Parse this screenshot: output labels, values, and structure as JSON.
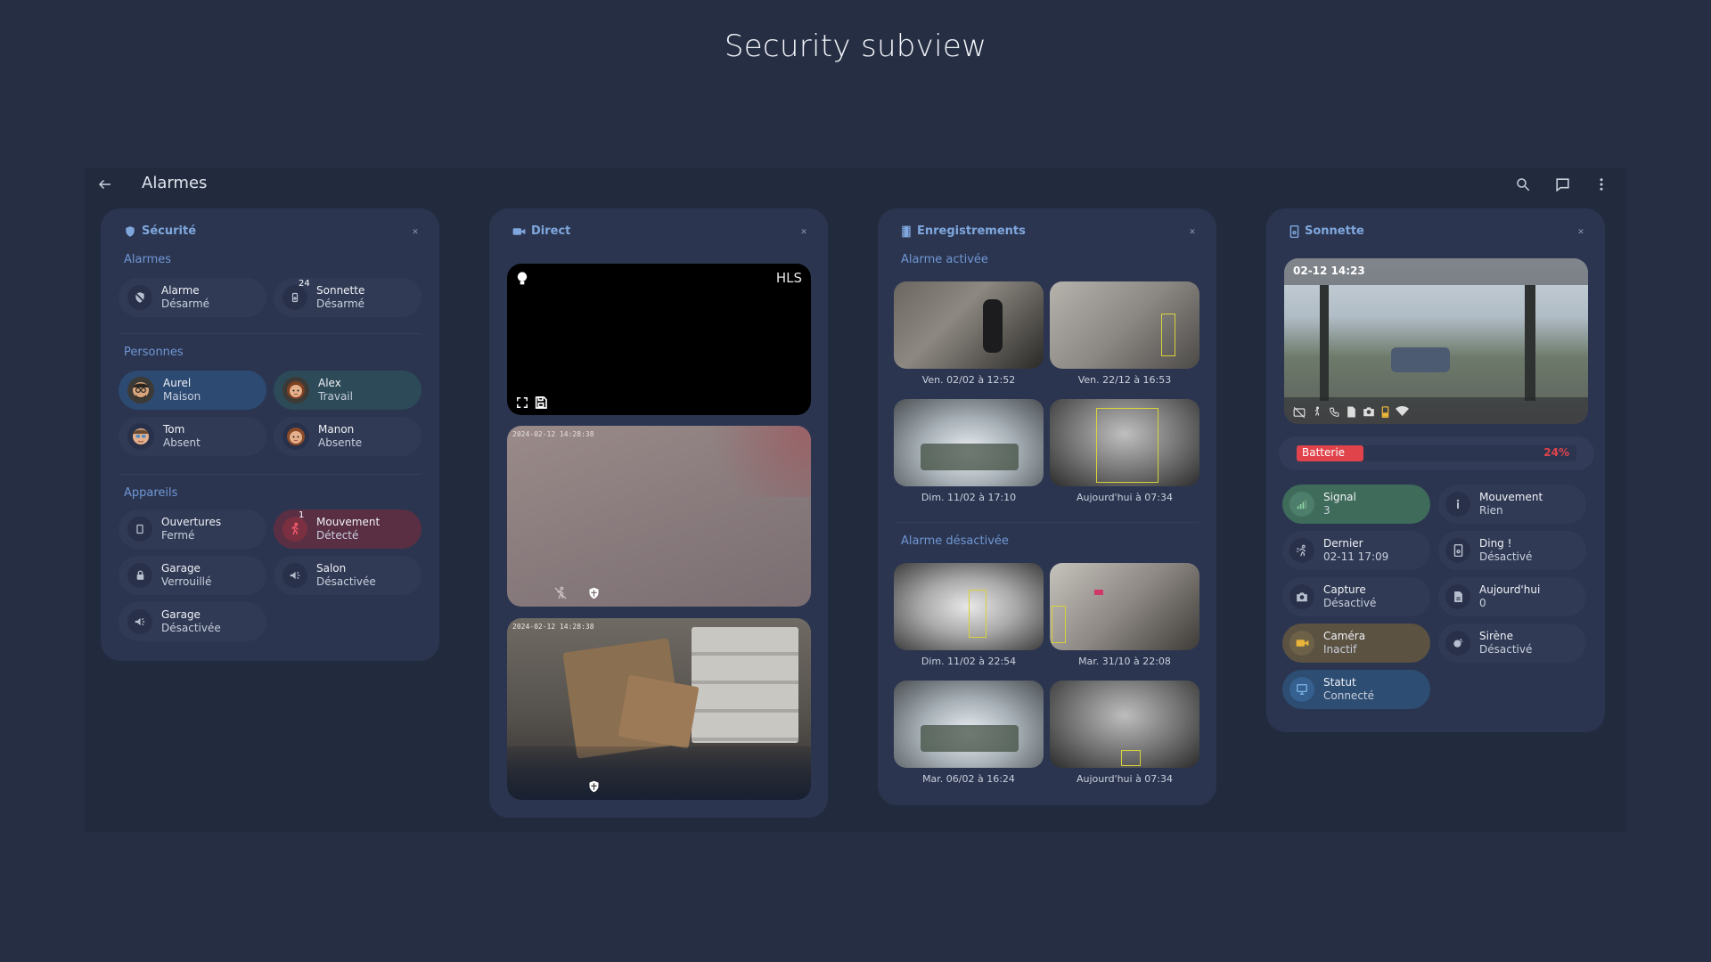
{
  "page_title": "Security subview",
  "topbar": {
    "title": "Alarmes",
    "back_icon": "arrow-left-icon",
    "actions": [
      "search-icon",
      "chat-icon",
      "more-vertical-icon"
    ]
  },
  "security": {
    "title": "Sécurité",
    "alarms_label": "Alarmes",
    "alarms": [
      {
        "name": "Alarme",
        "state": "Désarmé",
        "icon": "shield-off-icon"
      },
      {
        "name": "Sonnette",
        "state": "Désarmé",
        "icon": "doorbell-icon",
        "badge": "24"
      }
    ],
    "people_label": "Personnes",
    "people": [
      {
        "name": "Aurel",
        "state": "Maison"
      },
      {
        "name": "Alex",
        "state": "Travail"
      },
      {
        "name": "Tom",
        "state": "Absent"
      },
      {
        "name": "Manon",
        "state": "Absente"
      }
    ],
    "devices_label": "Appareils",
    "devices": [
      {
        "name": "Ouvertures",
        "state": "Fermé",
        "icon": "door-icon"
      },
      {
        "name": "Mouvement",
        "state": "Détecté",
        "icon": "motion-icon",
        "badge": "1"
      },
      {
        "name": "Garage",
        "state": "Verrouillé",
        "icon": "lock-icon"
      },
      {
        "name": "Salon",
        "state": "Désactivée",
        "icon": "siren-icon"
      },
      {
        "name": "Garage",
        "state": "Désactivée",
        "icon": "siren-icon"
      }
    ]
  },
  "live": {
    "title": "Direct",
    "hls_label": "HLS",
    "cam2_timestamp": "2024-02-12 14:28:38",
    "cam3_timestamp": "2024-02-12 14:28:38"
  },
  "recordings": {
    "title": "Enregistrements",
    "activated_label": "Alarme activée",
    "activated": [
      "Ven. 02/02 à 12:52",
      "Ven. 22/12 à 16:53",
      "Dim. 11/02 à 17:10",
      "Aujourd'hui à 07:34"
    ],
    "deactivated_label": "Alarme désactivée",
    "deactivated": [
      "Dim. 11/02 à 22:54",
      "Mar. 31/10 à 22:08",
      "Mar. 06/02 à 16:24",
      "Aujourd'hui à 07:34"
    ]
  },
  "doorbell": {
    "title": "Sonnette",
    "timestamp": "02-12 14:23",
    "battery_label": "Batterie",
    "battery_value": "24%",
    "battery_level": 0.24,
    "items": [
      {
        "name": "Signal",
        "state": "3",
        "icon": "signal-icon"
      },
      {
        "name": "Mouvement",
        "state": "Rien",
        "icon": "walk-icon"
      },
      {
        "name": "Dernier",
        "state": "02-11 17:09",
        "icon": "motion-icon"
      },
      {
        "name": "Ding !",
        "state": "Désactivé",
        "icon": "doorbell-icon"
      },
      {
        "name": "Capture",
        "state": "Désactivé",
        "icon": "camera-icon"
      },
      {
        "name": "Aujourd'hui",
        "state": "0",
        "icon": "file-icon"
      },
      {
        "name": "Caméra",
        "state": "Inactif",
        "icon": "video-icon"
      },
      {
        "name": "Sirène",
        "state": "Désactivé",
        "icon": "siren-icon"
      },
      {
        "name": "Statut",
        "state": "Connecté",
        "icon": "monitor-icon"
      }
    ]
  },
  "colors": {
    "background": "#252e43",
    "card": "#2b3550",
    "chip": "#303a55",
    "accent": "#7fa7dd",
    "person_home": "#2d4a72",
    "person_work": "#2c4a58",
    "motion_detected": "#5a2f44",
    "battery_red": "#e0434a",
    "signal_green": "#3f6b5a",
    "camera_gold": "#5b5242",
    "status_blue": "#2d4d73"
  }
}
